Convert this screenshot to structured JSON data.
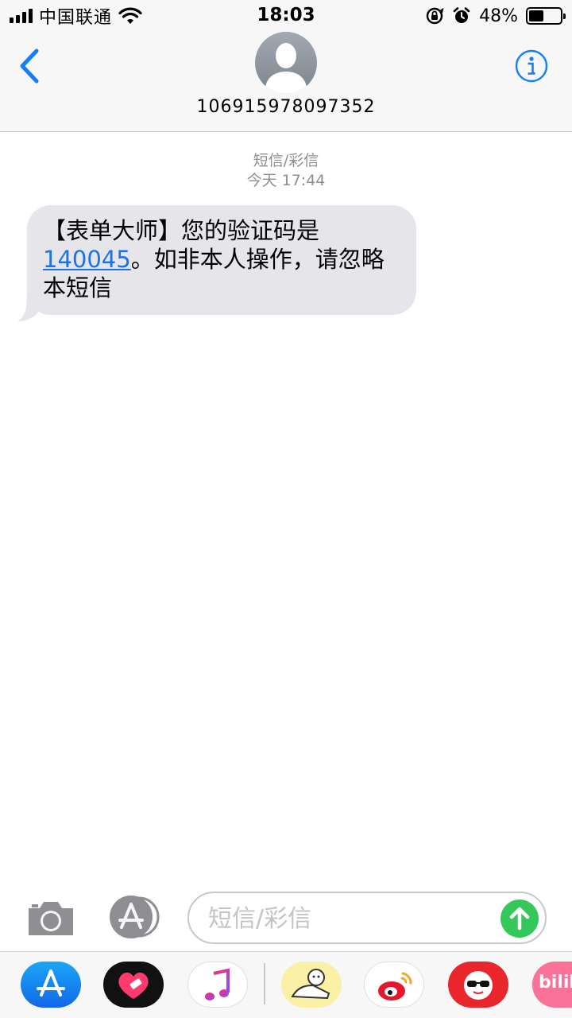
{
  "status_bar": {
    "carrier": "中国联通",
    "time": "18:03",
    "battery_percent": "48%",
    "battery_level": 0.48
  },
  "header": {
    "contact_number": "106915978097352",
    "back_icon": "chevron-left-icon",
    "info_icon": "info-icon"
  },
  "conversation": {
    "service_label": "短信/彩信",
    "timestamp": "今天 17:44",
    "message": {
      "text_before": "【表单大师】您的验证码是",
      "code": "140045",
      "text_after": "。如非本人操作，请忽略本短信"
    }
  },
  "input_bar": {
    "placeholder": "短信/彩信",
    "value": ""
  },
  "apps": [
    {
      "name": "app-store-icon"
    },
    {
      "name": "heart-app-icon"
    },
    {
      "name": "music-icon"
    },
    {
      "name": "sticker-icon"
    },
    {
      "name": "weibo-icon"
    },
    {
      "name": "red-face-app-icon"
    },
    {
      "name": "bilibili-icon",
      "label": "bilib"
    }
  ],
  "colors": {
    "accent": "#1a73e8",
    "ios_blue": "#147efb",
    "send_green": "#34c759",
    "bubble_gray": "#e5e5ea",
    "meta_gray": "#8e8e93"
  }
}
